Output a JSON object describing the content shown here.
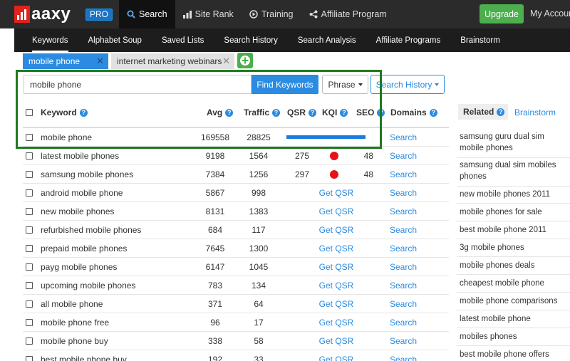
{
  "brand": {
    "logo_text": "aaxy",
    "badge": "PRO"
  },
  "topnav": {
    "items": [
      {
        "label": "Search",
        "icon": "search-icon",
        "active": true
      },
      {
        "label": "Site Rank",
        "icon": "bar-chart-icon"
      },
      {
        "label": "Training",
        "icon": "play-circle-icon"
      },
      {
        "label": "Affiliate Program",
        "icon": "share-icon"
      }
    ],
    "upgrade_label": "Upgrade",
    "account_label": "My Account"
  },
  "subnav": {
    "items": [
      "Keywords",
      "Alphabet Soup",
      "Saved Lists",
      "Search History",
      "Search Analysis",
      "Affiliate Programs",
      "Brainstorm"
    ],
    "active_index": 0
  },
  "keyword_tabs": [
    "mobile phone",
    "internet marketing webinars"
  ],
  "search": {
    "value": "mobile phone",
    "find_label": "Find Keywords",
    "phrase_label": "Phrase",
    "history_label": "Search History"
  },
  "table": {
    "headers": {
      "keyword": "Keyword",
      "avg": "Avg",
      "traffic": "Traffic",
      "qsr": "QSR",
      "kqi": "KQI",
      "seo": "SEO",
      "domains": "Domains"
    },
    "get_qsr_label": "Get QSR",
    "search_label": "Search",
    "rows": [
      {
        "keyword": "mobile phone",
        "avg": "169558",
        "traffic": "28825",
        "progress": 1.0
      },
      {
        "keyword": "latest mobile phones",
        "avg": "9198",
        "traffic": "1564",
        "qsr": "275",
        "kqi": "red",
        "seo": "48"
      },
      {
        "keyword": "samsung mobile phones",
        "avg": "7384",
        "traffic": "1256",
        "qsr": "297",
        "kqi": "red",
        "seo": "48"
      },
      {
        "keyword": "android mobile phone",
        "avg": "5867",
        "traffic": "998"
      },
      {
        "keyword": "new mobile phones",
        "avg": "8131",
        "traffic": "1383"
      },
      {
        "keyword": "refurbished mobile phones",
        "avg": "684",
        "traffic": "117"
      },
      {
        "keyword": "prepaid mobile phones",
        "avg": "7645",
        "traffic": "1300"
      },
      {
        "keyword": "payg mobile phones",
        "avg": "6147",
        "traffic": "1045"
      },
      {
        "keyword": "upcoming mobile phones",
        "avg": "783",
        "traffic": "134"
      },
      {
        "keyword": "all mobile phone",
        "avg": "371",
        "traffic": "64"
      },
      {
        "keyword": "mobile phone free",
        "avg": "96",
        "traffic": "17"
      },
      {
        "keyword": "mobile phone buy",
        "avg": "338",
        "traffic": "58"
      },
      {
        "keyword": "best mobile phone buy",
        "avg": "192",
        "traffic": "33"
      }
    ]
  },
  "related": {
    "tab_label": "Related",
    "brainstorm_label": "Brainstorm",
    "items": [
      "samsung guru dual sim mobile phones",
      "samsung dual sim mobiles phones",
      "new mobile phones 2011",
      "mobile phones for sale",
      "best mobile phone 2011",
      "3g mobile phones",
      "mobile phones deals",
      "cheapest mobile phone",
      "mobile phone comparisons",
      "latest mobile phone",
      "mobiles phones",
      "best mobile phone offers"
    ]
  },
  "colors": {
    "accent": "#2a8be0",
    "upgrade": "#4cae4c",
    "kqi_red": "#e8111a",
    "highlight": "#1e7b1e"
  }
}
